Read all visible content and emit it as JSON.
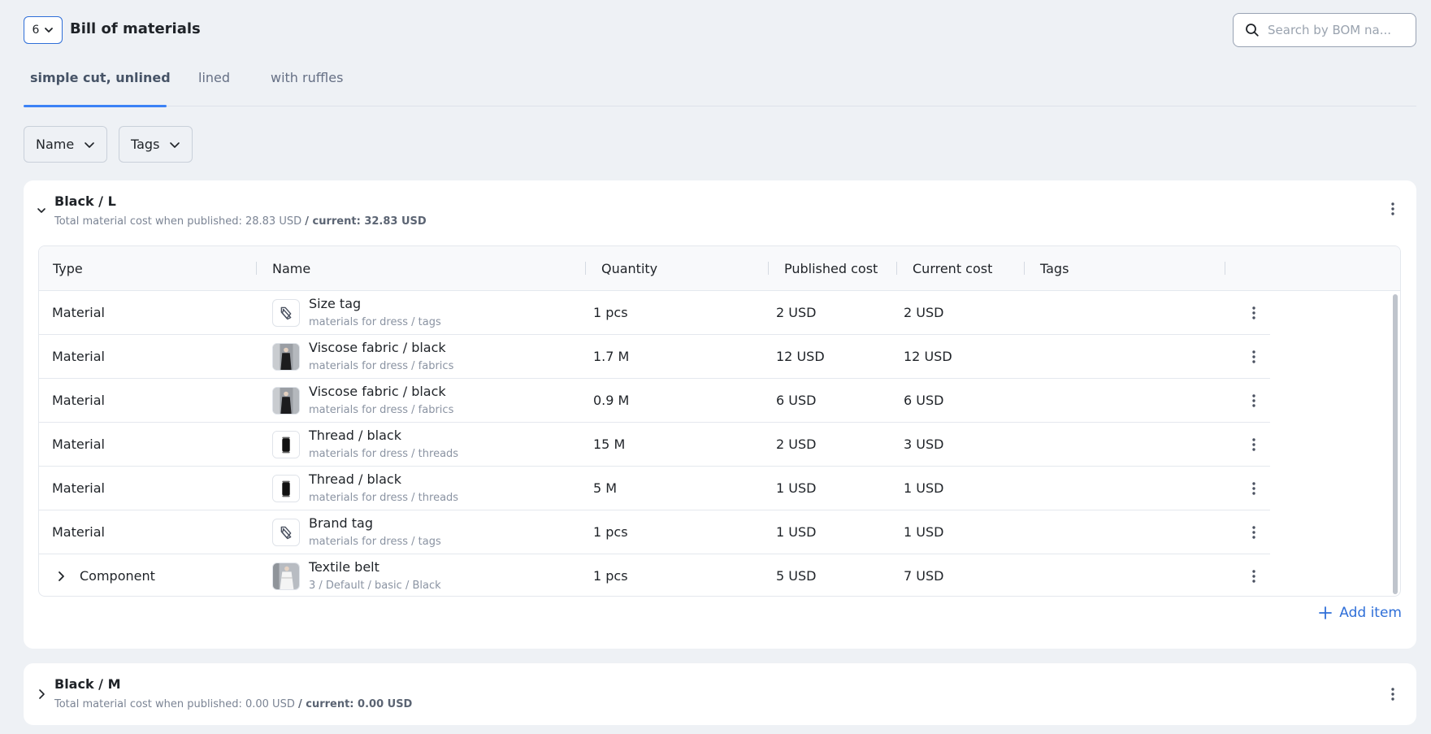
{
  "header": {
    "count_value": "6",
    "title": "Bill of materials",
    "search_placeholder": "Search by BOM na..."
  },
  "tabs": [
    {
      "label": "simple cut, unlined",
      "active": true
    },
    {
      "label": "lined",
      "active": false
    },
    {
      "label": "with ruffles",
      "active": false
    }
  ],
  "filters": [
    {
      "label": "Name"
    },
    {
      "label": "Tags"
    }
  ],
  "groups": [
    {
      "title": "Black / L",
      "published_text": "Total material cost when published: 28.83 USD",
      "current_text": "/ current: 32.83 USD",
      "expanded": true
    },
    {
      "title": "Black / M",
      "published_text": "Total material cost when published: 0.00 USD",
      "current_text": "/ current: 0.00 USD",
      "expanded": false
    }
  ],
  "table": {
    "columns": [
      "Type",
      "Name",
      "Quantity",
      "Published cost",
      "Current cost",
      "Tags"
    ],
    "rows": [
      {
        "type": "Material",
        "thumb": "tag-icon",
        "name": "Size tag",
        "path": "materials for dress / tags",
        "quantity": "1 pcs",
        "published": "2 USD",
        "current": "2 USD"
      },
      {
        "type": "Material",
        "thumb": "fabric-photo",
        "name": "Viscose fabric / black",
        "path": "materials for dress / fabrics",
        "quantity": "1.7 M",
        "published": "12 USD",
        "current": "12 USD"
      },
      {
        "type": "Material",
        "thumb": "fabric-photo",
        "name": "Viscose fabric / black",
        "path": "materials for dress / fabrics",
        "quantity": "0.9 M",
        "published": "6 USD",
        "current": "6 USD"
      },
      {
        "type": "Material",
        "thumb": "thread-photo",
        "name": "Thread / black",
        "path": "materials for dress / threads",
        "quantity": "15 M",
        "published": "2 USD",
        "current": "3 USD"
      },
      {
        "type": "Material",
        "thumb": "thread-photo",
        "name": "Thread / black",
        "path": "materials for dress / threads",
        "quantity": "5 M",
        "published": "1 USD",
        "current": "1 USD"
      },
      {
        "type": "Material",
        "thumb": "tag-icon",
        "name": "Brand tag",
        "path": "materials for dress / tags",
        "quantity": "1 pcs",
        "published": "1 USD",
        "current": "1 USD"
      },
      {
        "type": "Component",
        "thumb": "belt-photo",
        "name": "Textile belt",
        "path": "3 / Default / basic / Black",
        "quantity": "1 pcs",
        "published": "5 USD",
        "current": "7 USD"
      }
    ]
  },
  "actions": {
    "add_item": "Add item"
  },
  "colors": {
    "accent": "#2f6fd8",
    "tab_underline": "#3b82f6",
    "page_bg": "#eef1f5"
  }
}
